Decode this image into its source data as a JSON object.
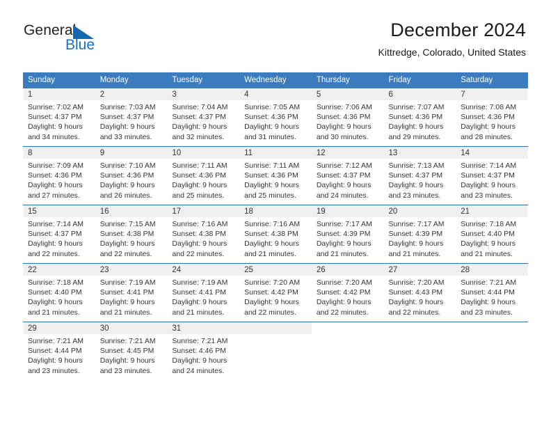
{
  "brand": {
    "name_part1": "General",
    "name_part2": "Blue",
    "accent_color": "#1570bb"
  },
  "header": {
    "title": "December 2024",
    "subtitle": "Kittredge, Colorado, United States"
  },
  "theme": {
    "header_row_bg": "#3a7cbe",
    "daynum_bg": "#f0f0f0",
    "row_divider": "#2f6fae",
    "text": "#333333"
  },
  "weekday_headers": [
    "Sunday",
    "Monday",
    "Tuesday",
    "Wednesday",
    "Thursday",
    "Friday",
    "Saturday"
  ],
  "weeks": [
    [
      {
        "day": "1",
        "sunrise": "Sunrise: 7:02 AM",
        "sunset": "Sunset: 4:37 PM",
        "daylight1": "Daylight: 9 hours",
        "daylight2": "and 34 minutes."
      },
      {
        "day": "2",
        "sunrise": "Sunrise: 7:03 AM",
        "sunset": "Sunset: 4:37 PM",
        "daylight1": "Daylight: 9 hours",
        "daylight2": "and 33 minutes."
      },
      {
        "day": "3",
        "sunrise": "Sunrise: 7:04 AM",
        "sunset": "Sunset: 4:37 PM",
        "daylight1": "Daylight: 9 hours",
        "daylight2": "and 32 minutes."
      },
      {
        "day": "4",
        "sunrise": "Sunrise: 7:05 AM",
        "sunset": "Sunset: 4:36 PM",
        "daylight1": "Daylight: 9 hours",
        "daylight2": "and 31 minutes."
      },
      {
        "day": "5",
        "sunrise": "Sunrise: 7:06 AM",
        "sunset": "Sunset: 4:36 PM",
        "daylight1": "Daylight: 9 hours",
        "daylight2": "and 30 minutes."
      },
      {
        "day": "6",
        "sunrise": "Sunrise: 7:07 AM",
        "sunset": "Sunset: 4:36 PM",
        "daylight1": "Daylight: 9 hours",
        "daylight2": "and 29 minutes."
      },
      {
        "day": "7",
        "sunrise": "Sunrise: 7:08 AM",
        "sunset": "Sunset: 4:36 PM",
        "daylight1": "Daylight: 9 hours",
        "daylight2": "and 28 minutes."
      }
    ],
    [
      {
        "day": "8",
        "sunrise": "Sunrise: 7:09 AM",
        "sunset": "Sunset: 4:36 PM",
        "daylight1": "Daylight: 9 hours",
        "daylight2": "and 27 minutes."
      },
      {
        "day": "9",
        "sunrise": "Sunrise: 7:10 AM",
        "sunset": "Sunset: 4:36 PM",
        "daylight1": "Daylight: 9 hours",
        "daylight2": "and 26 minutes."
      },
      {
        "day": "10",
        "sunrise": "Sunrise: 7:11 AM",
        "sunset": "Sunset: 4:36 PM",
        "daylight1": "Daylight: 9 hours",
        "daylight2": "and 25 minutes."
      },
      {
        "day": "11",
        "sunrise": "Sunrise: 7:11 AM",
        "sunset": "Sunset: 4:36 PM",
        "daylight1": "Daylight: 9 hours",
        "daylight2": "and 25 minutes."
      },
      {
        "day": "12",
        "sunrise": "Sunrise: 7:12 AM",
        "sunset": "Sunset: 4:37 PM",
        "daylight1": "Daylight: 9 hours",
        "daylight2": "and 24 minutes."
      },
      {
        "day": "13",
        "sunrise": "Sunrise: 7:13 AM",
        "sunset": "Sunset: 4:37 PM",
        "daylight1": "Daylight: 9 hours",
        "daylight2": "and 23 minutes."
      },
      {
        "day": "14",
        "sunrise": "Sunrise: 7:14 AM",
        "sunset": "Sunset: 4:37 PM",
        "daylight1": "Daylight: 9 hours",
        "daylight2": "and 23 minutes."
      }
    ],
    [
      {
        "day": "15",
        "sunrise": "Sunrise: 7:14 AM",
        "sunset": "Sunset: 4:37 PM",
        "daylight1": "Daylight: 9 hours",
        "daylight2": "and 22 minutes."
      },
      {
        "day": "16",
        "sunrise": "Sunrise: 7:15 AM",
        "sunset": "Sunset: 4:38 PM",
        "daylight1": "Daylight: 9 hours",
        "daylight2": "and 22 minutes."
      },
      {
        "day": "17",
        "sunrise": "Sunrise: 7:16 AM",
        "sunset": "Sunset: 4:38 PM",
        "daylight1": "Daylight: 9 hours",
        "daylight2": "and 22 minutes."
      },
      {
        "day": "18",
        "sunrise": "Sunrise: 7:16 AM",
        "sunset": "Sunset: 4:38 PM",
        "daylight1": "Daylight: 9 hours",
        "daylight2": "and 21 minutes."
      },
      {
        "day": "19",
        "sunrise": "Sunrise: 7:17 AM",
        "sunset": "Sunset: 4:39 PM",
        "daylight1": "Daylight: 9 hours",
        "daylight2": "and 21 minutes."
      },
      {
        "day": "20",
        "sunrise": "Sunrise: 7:17 AM",
        "sunset": "Sunset: 4:39 PM",
        "daylight1": "Daylight: 9 hours",
        "daylight2": "and 21 minutes."
      },
      {
        "day": "21",
        "sunrise": "Sunrise: 7:18 AM",
        "sunset": "Sunset: 4:40 PM",
        "daylight1": "Daylight: 9 hours",
        "daylight2": "and 21 minutes."
      }
    ],
    [
      {
        "day": "22",
        "sunrise": "Sunrise: 7:18 AM",
        "sunset": "Sunset: 4:40 PM",
        "daylight1": "Daylight: 9 hours",
        "daylight2": "and 21 minutes."
      },
      {
        "day": "23",
        "sunrise": "Sunrise: 7:19 AM",
        "sunset": "Sunset: 4:41 PM",
        "daylight1": "Daylight: 9 hours",
        "daylight2": "and 21 minutes."
      },
      {
        "day": "24",
        "sunrise": "Sunrise: 7:19 AM",
        "sunset": "Sunset: 4:41 PM",
        "daylight1": "Daylight: 9 hours",
        "daylight2": "and 21 minutes."
      },
      {
        "day": "25",
        "sunrise": "Sunrise: 7:20 AM",
        "sunset": "Sunset: 4:42 PM",
        "daylight1": "Daylight: 9 hours",
        "daylight2": "and 22 minutes."
      },
      {
        "day": "26",
        "sunrise": "Sunrise: 7:20 AM",
        "sunset": "Sunset: 4:42 PM",
        "daylight1": "Daylight: 9 hours",
        "daylight2": "and 22 minutes."
      },
      {
        "day": "27",
        "sunrise": "Sunrise: 7:20 AM",
        "sunset": "Sunset: 4:43 PM",
        "daylight1": "Daylight: 9 hours",
        "daylight2": "and 22 minutes."
      },
      {
        "day": "28",
        "sunrise": "Sunrise: 7:21 AM",
        "sunset": "Sunset: 4:44 PM",
        "daylight1": "Daylight: 9 hours",
        "daylight2": "and 23 minutes."
      }
    ],
    [
      {
        "day": "29",
        "sunrise": "Sunrise: 7:21 AM",
        "sunset": "Sunset: 4:44 PM",
        "daylight1": "Daylight: 9 hours",
        "daylight2": "and 23 minutes."
      },
      {
        "day": "30",
        "sunrise": "Sunrise: 7:21 AM",
        "sunset": "Sunset: 4:45 PM",
        "daylight1": "Daylight: 9 hours",
        "daylight2": "and 23 minutes."
      },
      {
        "day": "31",
        "sunrise": "Sunrise: 7:21 AM",
        "sunset": "Sunset: 4:46 PM",
        "daylight1": "Daylight: 9 hours",
        "daylight2": "and 24 minutes."
      },
      {
        "day": "",
        "sunrise": "",
        "sunset": "",
        "daylight1": "",
        "daylight2": ""
      },
      {
        "day": "",
        "sunrise": "",
        "sunset": "",
        "daylight1": "",
        "daylight2": ""
      },
      {
        "day": "",
        "sunrise": "",
        "sunset": "",
        "daylight1": "",
        "daylight2": ""
      },
      {
        "day": "",
        "sunrise": "",
        "sunset": "",
        "daylight1": "",
        "daylight2": ""
      }
    ]
  ]
}
